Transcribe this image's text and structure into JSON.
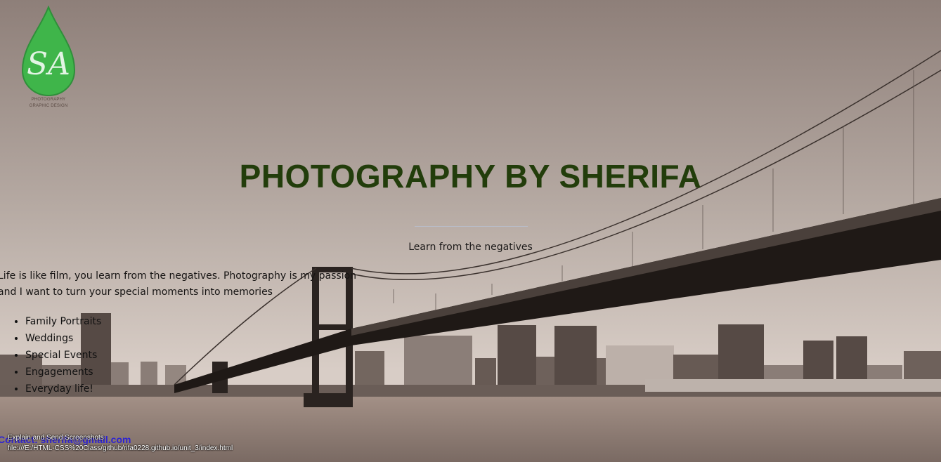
{
  "header": {
    "logo_letters": "SA",
    "logo_line1": "PHOTOGRAPHY",
    "logo_line2": "GRAPHIC DESIGN",
    "title": "PHOTOGRAPHY BY SHERIFA",
    "tagline": "Learn from the negatives"
  },
  "intro": {
    "line1": "Life is like film, you learn from the negatives. Photography is my passion",
    "line2": "and I want to turn your special moments into memories"
  },
  "services": [
    "Family Portraits",
    "Weddings",
    "Special Events",
    "Engagements",
    "Everyday life!"
  ],
  "contact": {
    "email": "Contact: sherifa@gmail.com"
  },
  "browser_overlay": {
    "action_label": "Explain and Send Screenshots",
    "status_url": "file:///E:/HTML-CSS%20Class/github/rifa0228.github.io/unit_3/index.html"
  },
  "colors": {
    "title": "#223d0b",
    "logo_green": "#3fb54a",
    "link": "#2d22d2",
    "sky_top": "#8e7f79",
    "sky_bottom": "#d8cdc6"
  }
}
